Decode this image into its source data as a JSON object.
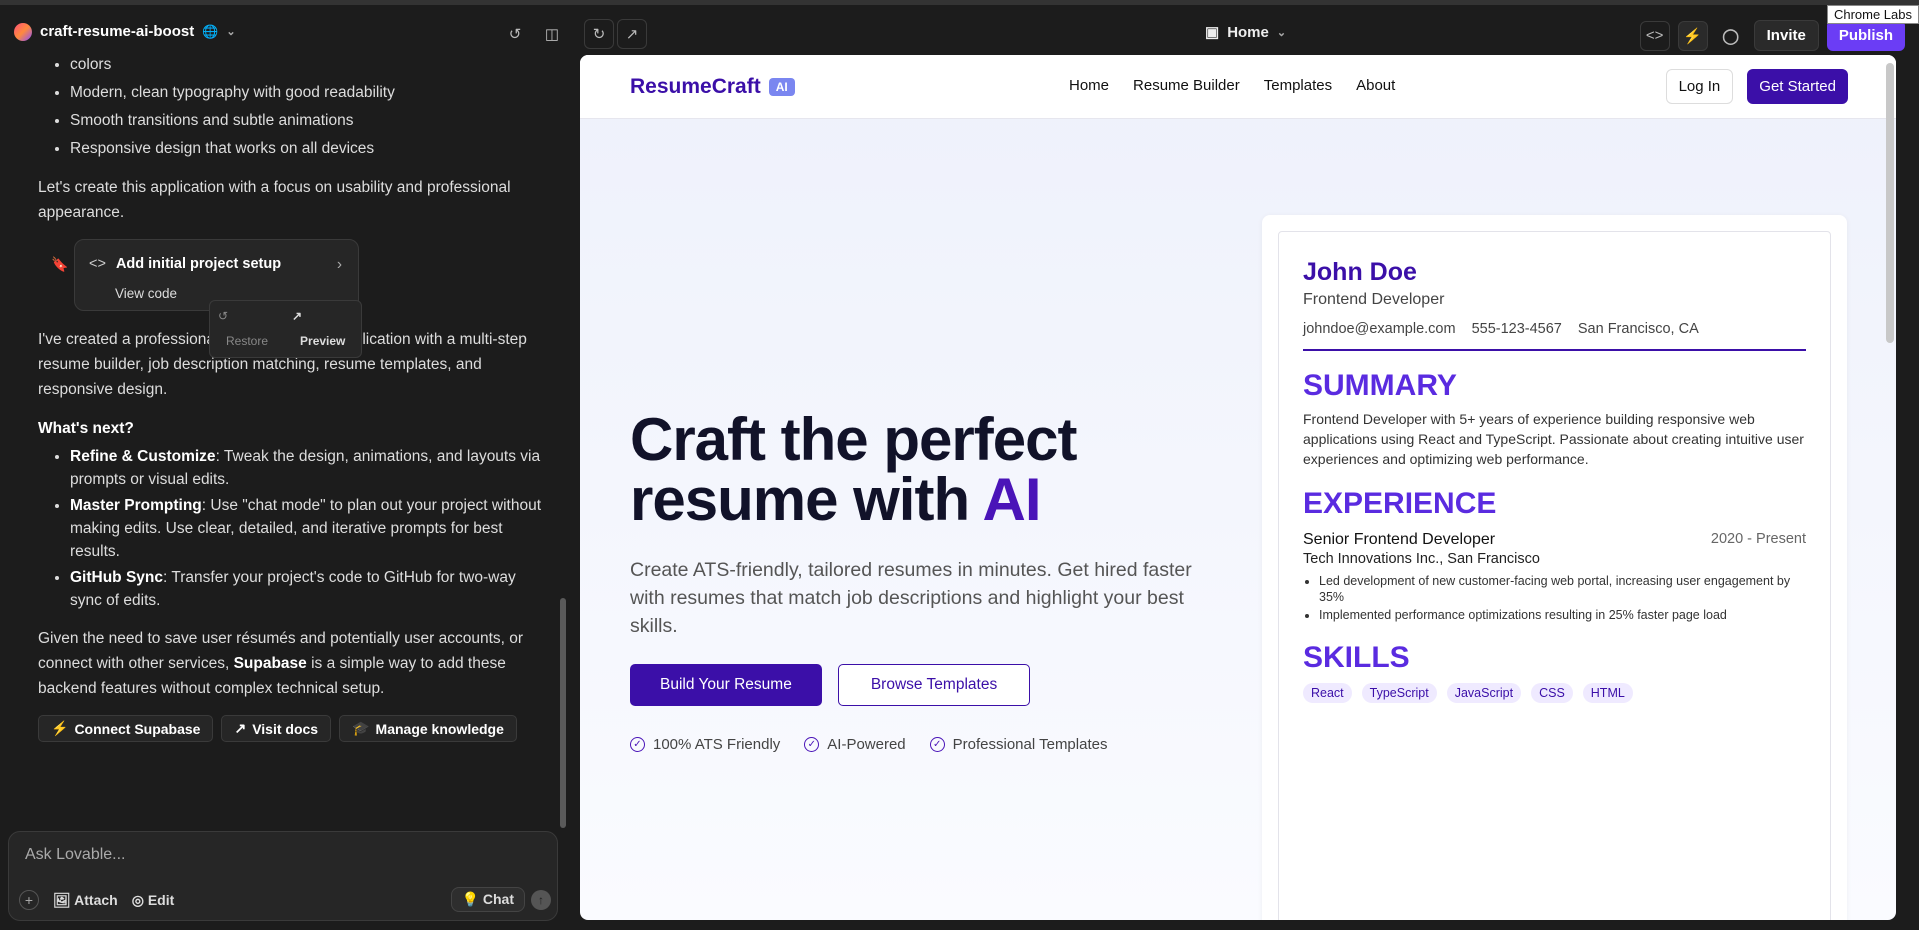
{
  "topbar": {
    "project_name": "craft-resume-ai-boost",
    "page_selector": "Home",
    "invite_label": "Invite",
    "publish_label": "Publish",
    "tooltip": "Chrome Labs"
  },
  "chat": {
    "list_top": [
      "colors",
      "Modern, clean typography with good readability",
      "Smooth transitions and subtle animations",
      "Responsive design that works on all devices"
    ],
    "para1": "Let's create this application with a focus on usability and professional appearance.",
    "code_card": {
      "title": "Add initial project setup",
      "view": "View code",
      "restore": "Restore",
      "preview": "Preview"
    },
    "para2": "I've created a professional ResumeCraft AI application with a multi-step resume builder, job description matching, resume templates, and responsive design.",
    "next_heading": "What's next?",
    "next_items": [
      {
        "bold": "Refine & Customize",
        "text": ": Tweak the design, animations, and layouts via prompts or visual edits."
      },
      {
        "bold": "Master Prompting",
        "text": ": Use \"chat mode\" to plan out your project without making edits. Use clear, detailed, and iterative prompts for best results."
      },
      {
        "bold": "GitHub Sync",
        "text": ": Transfer your project's code to GitHub for two-way sync of edits."
      }
    ],
    "para3_pre": "Given the need to save user résumés and potentially user accounts, or connect with other services, ",
    "para3_bold": "Supabase",
    "para3_post": " is a simple way to add these backend features without complex technical setup.",
    "chips": [
      "Connect Supabase",
      "Visit docs",
      "Manage knowledge"
    ],
    "input_placeholder": "Ask Lovable...",
    "attach_label": "Attach",
    "edit_label": "Edit",
    "chat_label": "Chat"
  },
  "preview": {
    "brand": "ResumeCraft",
    "brand_badge": "AI",
    "nav_links": [
      "Home",
      "Resume Builder",
      "Templates",
      "About"
    ],
    "login_label": "Log In",
    "get_started_label": "Get Started",
    "hero_line1": "Craft the perfect",
    "hero_line2": "resume with ",
    "hero_ai": "AI",
    "hero_sub": "Create ATS-friendly, tailored resumes in minutes. Get hired faster with resumes that match job descriptions and highlight your best skills.",
    "build_label": "Build Your Resume",
    "browse_label": "Browse Templates",
    "features": [
      "100% ATS Friendly",
      "AI-Powered",
      "Professional Templates"
    ],
    "resume": {
      "name": "John Doe",
      "role": "Frontend Developer",
      "email": "johndoe@example.com",
      "phone": "555-123-4567",
      "location": "San Francisco, CA",
      "summary_heading": "SUMMARY",
      "summary": "Frontend Developer with 5+ years of experience building responsive web applications using React and TypeScript. Passionate about creating intuitive user experiences and optimizing web performance.",
      "experience_heading": "EXPERIENCE",
      "job_title": "Senior Frontend Developer",
      "job_dates": "2020 - Present",
      "company": "Tech Innovations Inc., San Francisco",
      "bullets": [
        "Led development of new customer-facing web portal, increasing user engagement by 35%",
        "Implemented performance optimizations resulting in 25% faster page load"
      ],
      "skills_heading": "SKILLS",
      "skills": [
        "React",
        "TypeScript",
        "JavaScript",
        "CSS",
        "HTML"
      ]
    }
  }
}
